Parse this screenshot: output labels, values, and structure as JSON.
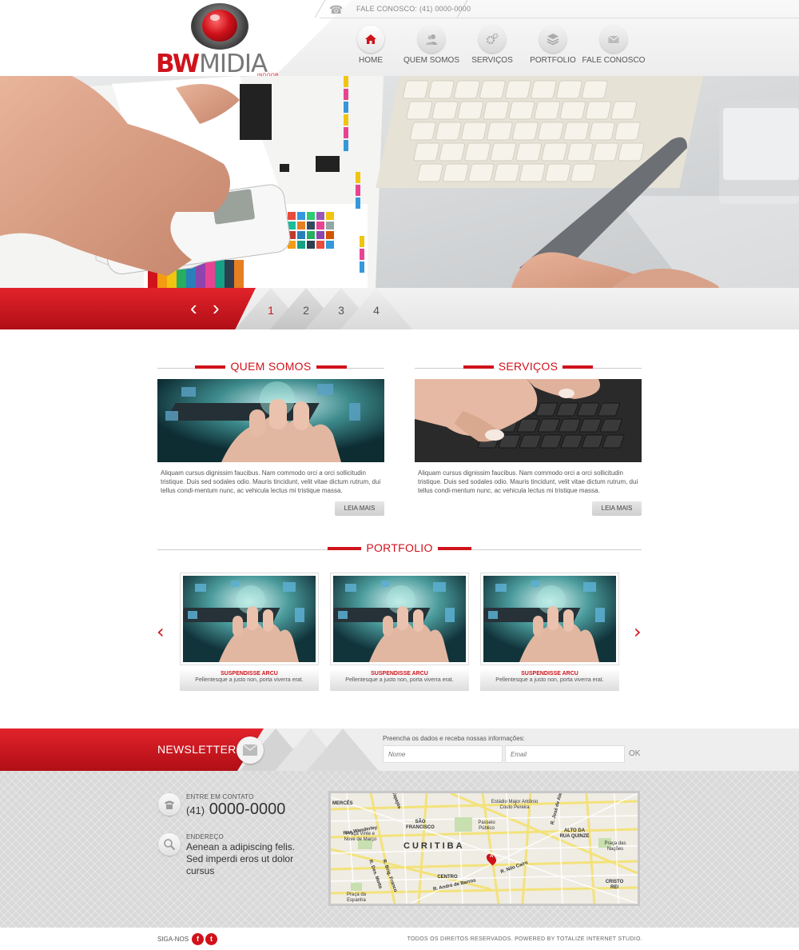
{
  "header": {
    "contact_top": "FALE CONOSCO: (41) 0000-0000",
    "logo_bw": "BW",
    "logo_midia": "MIDIA",
    "logo_sub": "INDOOR",
    "nav": [
      {
        "label": "HOME",
        "icon": "home-icon"
      },
      {
        "label": "QUEM SOMOS",
        "icon": "users-icon"
      },
      {
        "label": "SERVIÇOS",
        "icon": "gears-icon"
      },
      {
        "label": "PORTFOLIO",
        "icon": "layers-icon"
      },
      {
        "label": "FALE CONOSCO",
        "icon": "mail-icon"
      }
    ]
  },
  "slider": {
    "prev": "‹",
    "next": "›",
    "pages": [
      "1",
      "2",
      "3",
      "4"
    ],
    "active_page": "1"
  },
  "about": {
    "title": "QUEM SOMOS",
    "text": "Aliquam cursus dignissim faucibus. Nam commodo orci a orci sollicitudin tristique. Duis sed sodales odio. Mauris tincidunt, velit vitae dictum rutrum, dui tellus condi-mentum nunc, ac vehicula lectus mi tristique massa.",
    "button": "LEIA MAIS"
  },
  "services": {
    "title": "SERVIÇOS",
    "text": "Aliquam cursus dignissim faucibus. Nam commodo orci a orci sollicitudin tristique. Duis sed sodales odio. Mauris tincidunt, velit vitae dictum rutrum, dui tellus condi-mentum nunc, ac vehicula lectus mi tristique massa.",
    "button": "LEIA MAIS"
  },
  "portfolio": {
    "title": "PORTFOLIO",
    "prev": "‹",
    "next": "›",
    "items": [
      {
        "title": "SUSPENDISSE ARCU",
        "desc": "Pellentesque a justo non, porta viverra erat."
      },
      {
        "title": "SUSPENDISSE ARCU",
        "desc": "Pellentesque a justo non, porta viverra erat."
      },
      {
        "title": "SUSPENDISSE ARCU",
        "desc": "Pellentesque a justo non, porta viverra erat."
      }
    ]
  },
  "newsletter": {
    "label": "NEWSLETTER",
    "prompt": "Preencha os dados e receba nossas informações:",
    "name_placeholder": "Nome",
    "email_placeholder": "Email",
    "ok": "OK"
  },
  "contact": {
    "phone_label": "ENTRE EM CONTATO",
    "phone_area": "(41)",
    "phone_number": "0000-0000",
    "address_label": "ENDEREÇO",
    "address": "Aenean a adipiscing felis. Sed imperdi eros ut dolor cursus"
  },
  "map": {
    "city": "CURITIBA",
    "pin": "A",
    "labels": [
      "MERCÊS",
      "R. Tapajós",
      "Alameda Princesa Izabel",
      "Rua Wanderley",
      "SÃO FRANCISCO",
      "Passeio Público",
      "Estádio Major Antônio Couto Pereira",
      "R. José de Alencar",
      "ALTO DA RUA QUINZE",
      "Praça Vinte e Nove de Março",
      "Praça das Nações",
      "CENTRO",
      "R. Nilo Cairo",
      "R. André de Barros",
      "Praça da Espanha",
      "CRISTO REI",
      "R. Des. Motta",
      "R. Brig. Franco",
      "R. Tibagi"
    ]
  },
  "footer": {
    "follow": "SIGA-NOS",
    "facebook": "f",
    "twitter": "t",
    "copyright": "TODOS OS DIREITOS RESERVADOS. POWERED BY TOTALIZE INTERNET STUDIO."
  },
  "colors": {
    "accent": "#d0121b",
    "accent_dark": "#b10e16",
    "light_gray": "#eeeeee"
  }
}
